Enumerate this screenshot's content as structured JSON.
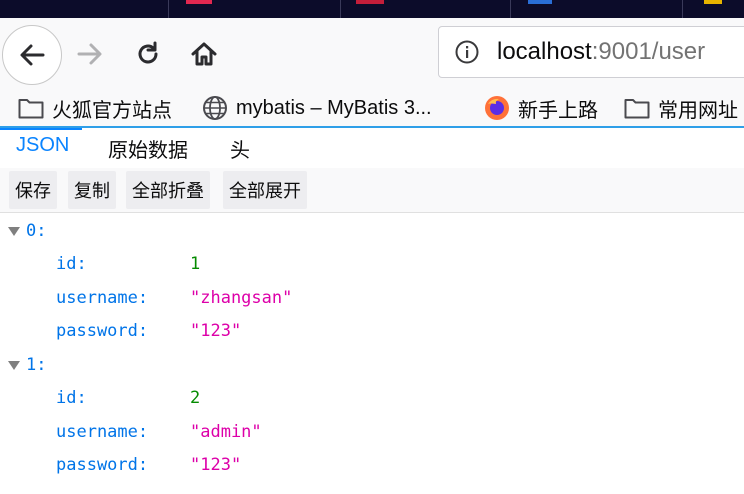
{
  "browser": {
    "url_host": "localhost",
    "url_rest": ":9001/user"
  },
  "bookmarks": [
    {
      "label": "火狐官方站点",
      "icon": "folder-icon"
    },
    {
      "label": "mybatis – MyBatis 3...",
      "icon": "globe-icon"
    },
    {
      "label": "新手上路",
      "icon": "firefox-icon"
    },
    {
      "label": "常用网址",
      "icon": "folder-icon"
    }
  ],
  "viewer_tabs": [
    {
      "label": "JSON",
      "active": true
    },
    {
      "label": "原始数据",
      "active": false
    },
    {
      "label": "头",
      "active": false
    }
  ],
  "toolbar": {
    "save": "保存",
    "copy": "复制",
    "collapse_all": "全部折叠",
    "expand_all": "全部展开"
  },
  "json": [
    {
      "index": "0:",
      "fields": [
        {
          "key": "id:",
          "value": "1",
          "type": "number"
        },
        {
          "key": "username:",
          "value": "\"zhangsan\"",
          "type": "string"
        },
        {
          "key": "password:",
          "value": "\"123\"",
          "type": "string"
        }
      ]
    },
    {
      "index": "1:",
      "fields": [
        {
          "key": "id:",
          "value": "2",
          "type": "number"
        },
        {
          "key": "username:",
          "value": "\"admin\"",
          "type": "string"
        },
        {
          "key": "password:",
          "value": "\"123\"",
          "type": "string"
        }
      ]
    }
  ],
  "colors": {
    "key": "#0074e8",
    "number": "#058b00",
    "string": "#dd00a9",
    "accent": "#0a84ff"
  }
}
